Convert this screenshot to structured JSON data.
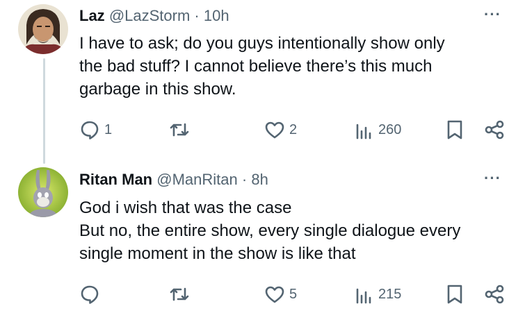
{
  "tweets": [
    {
      "name": "Laz",
      "handle": "@LazStorm",
      "separator": "·",
      "time": "10h",
      "more": "···",
      "lines": [
        "I have to ask; do you guys intentionally show only",
        "the bad stuff? I cannot believe there’s this much",
        "garbage in this show."
      ],
      "replies": "1",
      "retweets": "",
      "likes": "2",
      "views": "260"
    },
    {
      "name": "Ritan Man",
      "handle": "@ManRitan",
      "separator": "·",
      "time": "8h",
      "more": "···",
      "lines": [
        "God i wish that was the case",
        "But no, the entire show, every single dialogue every",
        "single moment in the show is like that"
      ],
      "replies": "",
      "retweets": "",
      "likes": "5",
      "views": "215"
    }
  ],
  "colors": {
    "text": "#0f1419",
    "secondary": "#536471",
    "thread_line": "#cfd9de"
  },
  "icons": [
    "reply-icon",
    "retweet-icon",
    "like-icon",
    "views-icon",
    "bookmark-icon",
    "share-icon"
  ]
}
